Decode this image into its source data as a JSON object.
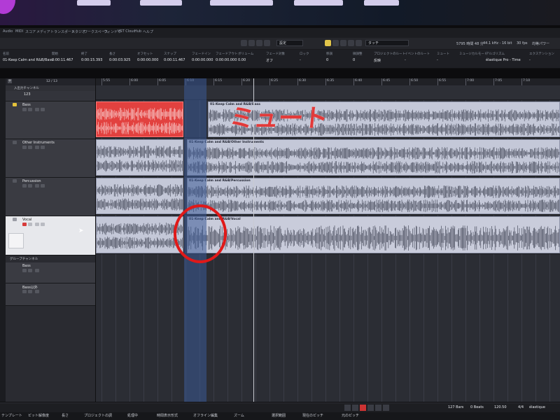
{
  "menu": {
    "items": [
      "Audio",
      "MIDI",
      "スコア",
      "メディア",
      "トランスポート",
      "スタジオ",
      "ワークスペース",
      "ウィンドウ",
      "VST Cloud",
      "Hub",
      "ヘルプ"
    ]
  },
  "toolbar": {
    "mode_label": "設定",
    "automation_label": "タッチ",
    "record_time": "5795 時間 48 分",
    "sample_rate": "44.1 kHz - 16 bit",
    "frame_rate": "30 fps",
    "project_pan": "プロジェクトのパン補正",
    "pan_law": "均等パワー"
  },
  "infoline": {
    "columns": [
      {
        "label": "名前",
        "value": "01-Keep Calm and R&B/Bass"
      },
      {
        "label": "開始",
        "value": "0:00:11.467"
      },
      {
        "label": "終了",
        "value": "0:00:15.393"
      },
      {
        "label": "長さ",
        "value": "0:00:03.925"
      },
      {
        "label": "オフセット",
        "value": "0:00:00.000"
      },
      {
        "label": "スナップ",
        "value": "0:00:11.467"
      },
      {
        "label": "フェードイン",
        "value": "0:00:00.000"
      },
      {
        "label": "フェードアウト",
        "value": "0:00:00.000"
      },
      {
        "label": "ボリューム",
        "value": "0.00"
      },
      {
        "label": "フェード対象",
        "value": "オフ"
      },
      {
        "label": "ロック",
        "value": "-"
      },
      {
        "label": "移調",
        "value": "0"
      },
      {
        "label": "微調整",
        "value": "0"
      },
      {
        "label": "プロジェクトのルート",
        "value": "反映"
      },
      {
        "label": "イベントのルート",
        "value": "-"
      },
      {
        "label": "ミュート",
        "value": "-"
      },
      {
        "label": "ミュージカルモード",
        "value": ""
      },
      {
        "label": "アルゴリズム",
        "value": "élastique Pro - Time"
      },
      {
        "label": "エクステンション",
        "value": "-"
      }
    ]
  },
  "trackheads": {
    "input_label": "入出力チャンネル",
    "counter": "12 / 13",
    "folder": "123",
    "tracks": [
      {
        "name": "Bass"
      },
      {
        "name": "Other Instruments"
      },
      {
        "name": "Percussion"
      },
      {
        "name": "Vocal"
      }
    ],
    "group_label": "グループチャンネル",
    "groups": [
      {
        "name": "Bass"
      },
      {
        "name": "Bass以外"
      }
    ]
  },
  "ruler": {
    "labels": [
      "5:55",
      "6:00",
      "6:05",
      "6:10",
      "6:15",
      "6:20",
      "6:25",
      "6:30",
      "6:35",
      "6:40",
      "6:45",
      "6:50",
      "6:55",
      "7:00",
      "7:05",
      "7:10"
    ]
  },
  "clips": {
    "bass": "01-Keep Calm and R&B/Bass",
    "other": "01-Keep Calm and R&B/Other Instruments",
    "perc": "01-Keep Calm and R&B/Percussion",
    "vocal": "01-Keep Calm and R&B/Vocal"
  },
  "annotation": {
    "mute_text": "ミュート"
  },
  "transport": {
    "bars": "127 Bars",
    "beats": "0 Beats",
    "tempo": "120.50",
    "signature": "4/4",
    "algo": "élastique"
  },
  "statusbar": {
    "items": [
      "テンプレート",
      "ピット解像度",
      "長さ",
      "プロジェクトの調",
      "処理中",
      "時間表示形式",
      "オフライン編集",
      "ズーム",
      "選択範囲",
      "現在のピッチ",
      "元のピッチ"
    ]
  },
  "colors": {
    "muted_clip": "#e2413f",
    "normal_clip": "#c4c8d8",
    "annotation": "#e23a3a"
  }
}
